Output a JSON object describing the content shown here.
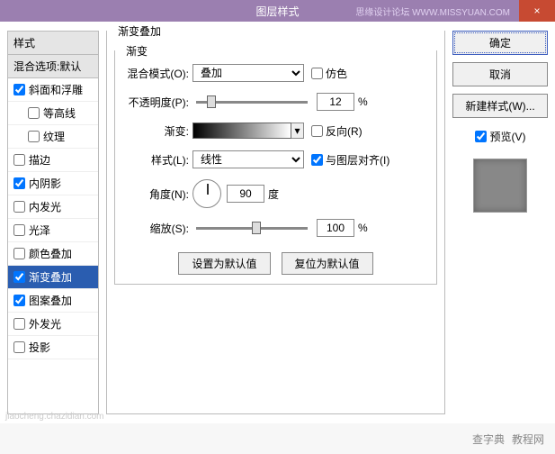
{
  "titlebar": {
    "title": "图层样式",
    "site": "思缘设计论坛 WWW.MISSYUAN.COM",
    "close": "×"
  },
  "styles": {
    "header": "样式",
    "blend_header": "混合选项:默认",
    "items": [
      {
        "label": "斜面和浮雕",
        "checked": true,
        "indented": false
      },
      {
        "label": "等高线",
        "checked": false,
        "indented": true
      },
      {
        "label": "纹理",
        "checked": false,
        "indented": true
      },
      {
        "label": "描边",
        "checked": false,
        "indented": false
      },
      {
        "label": "内阴影",
        "checked": true,
        "indented": false
      },
      {
        "label": "内发光",
        "checked": false,
        "indented": false
      },
      {
        "label": "光泽",
        "checked": false,
        "indented": false
      },
      {
        "label": "颜色叠加",
        "checked": false,
        "indented": false
      },
      {
        "label": "渐变叠加",
        "checked": true,
        "indented": false,
        "selected": true
      },
      {
        "label": "图案叠加",
        "checked": true,
        "indented": false
      },
      {
        "label": "外发光",
        "checked": false,
        "indented": false
      },
      {
        "label": "投影",
        "checked": false,
        "indented": false
      }
    ]
  },
  "center": {
    "group_title": "渐变叠加",
    "inner_title": "渐变",
    "blend_mode_label": "混合模式(O):",
    "blend_mode_value": "叠加",
    "dither_label": "仿色",
    "opacity_label": "不透明度(P):",
    "opacity_value": "12",
    "gradient_label": "渐变:",
    "gradient_arrow": "▾",
    "reverse_label": "反向(R)",
    "style_label": "样式(L):",
    "style_value": "线性",
    "align_label": "与图层对齐(I)",
    "angle_label": "角度(N):",
    "angle_value": "90",
    "angle_unit": "度",
    "scale_label": "缩放(S):",
    "scale_value": "100",
    "pct": "%",
    "reset_default": "设置为默认值",
    "restore_default": "复位为默认值"
  },
  "right": {
    "ok": "确定",
    "cancel": "取消",
    "new_style": "新建样式(W)...",
    "preview": "预览(V)"
  },
  "footer": {
    "watermark_url": "jiaocheng.chazidian.com",
    "brand1": "查字典",
    "brand2": "教程网"
  }
}
